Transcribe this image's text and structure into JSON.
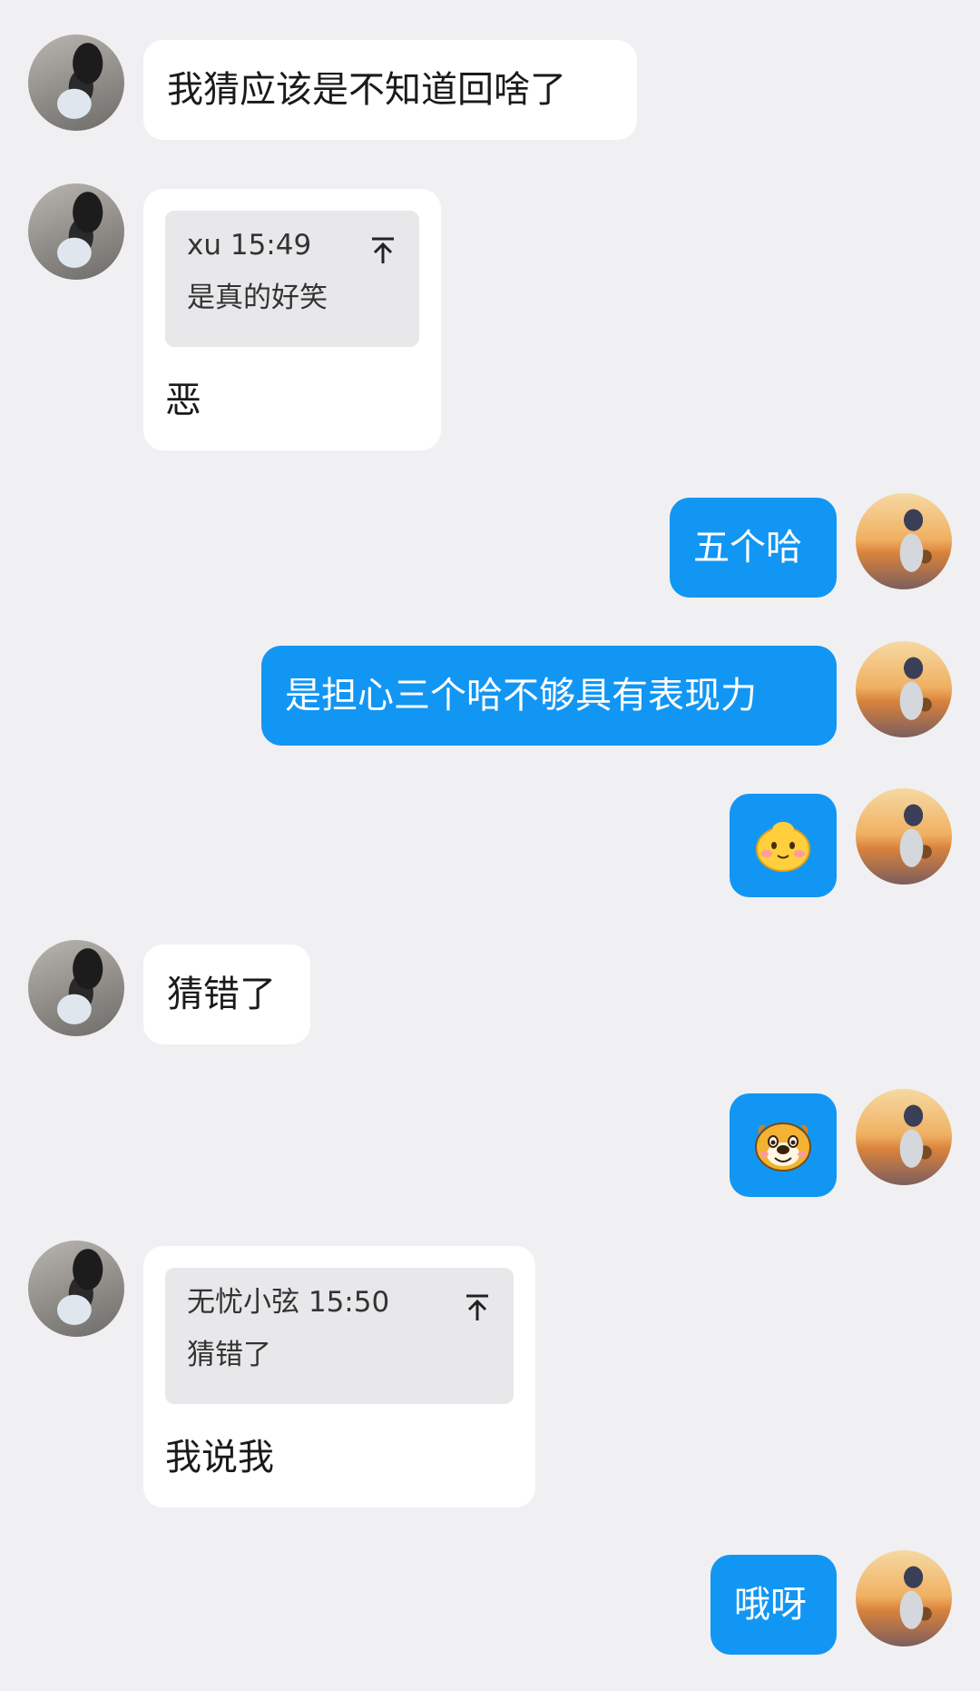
{
  "messages": [
    {
      "id": 1,
      "side": "left",
      "avatar": "girl-avatar",
      "text": "我猜应该是不知道回啥了"
    },
    {
      "id": 2,
      "side": "left",
      "avatar": "girl-avatar",
      "quote": {
        "sender": "xu",
        "time": "15:49",
        "text": "是真的好笑"
      },
      "text": "恶"
    },
    {
      "id": 3,
      "side": "right",
      "avatar": "boy-avatar",
      "text": "五个哈"
    },
    {
      "id": 4,
      "side": "right",
      "avatar": "boy-avatar",
      "text": "是担心三个哈不够具有表现力"
    },
    {
      "id": 5,
      "side": "right",
      "avatar": "boy-avatar",
      "sticker": "blushing-face-emoji"
    },
    {
      "id": 6,
      "side": "left",
      "avatar": "girl-avatar",
      "text": "猜错了"
    },
    {
      "id": 7,
      "side": "right",
      "avatar": "boy-avatar",
      "sticker": "dog-face-emoji"
    },
    {
      "id": 8,
      "side": "left",
      "avatar": "girl-avatar",
      "quote": {
        "sender": "无忧小弦",
        "time": "15:50",
        "text": "猜错了"
      },
      "text": "我说我"
    },
    {
      "id": 9,
      "side": "right",
      "avatar": "boy-avatar",
      "text": "哦呀"
    }
  ],
  "colors": {
    "background": "#f0f0f2",
    "outgoing_bubble": "#1296f3",
    "incoming_bubble": "#ffffff",
    "quote_background": "#e8e8ea"
  }
}
